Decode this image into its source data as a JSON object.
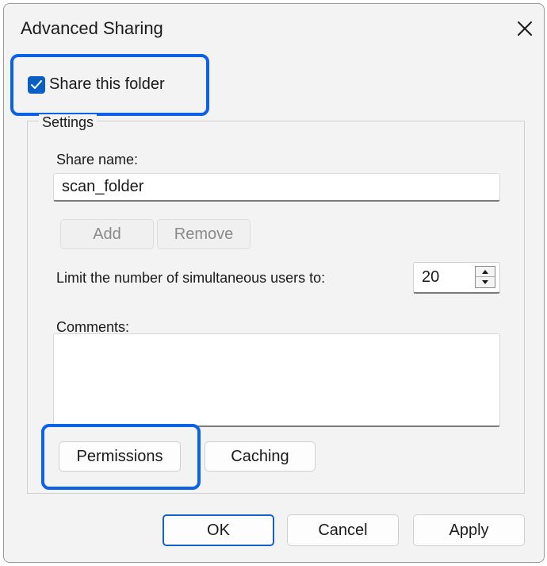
{
  "window": {
    "title": "Advanced Sharing",
    "close_icon": "close-icon"
  },
  "share": {
    "checkbox_label": "Share this folder",
    "checked": true
  },
  "settings": {
    "group_label": "Settings",
    "share_name_label": "Share name:",
    "share_name_value": "scan_folder",
    "add_label": "Add",
    "remove_label": "Remove",
    "limit_label": "Limit the number of simultaneous users to:",
    "limit_value": "20",
    "comments_label": "Comments:",
    "comments_value": "",
    "permissions_label": "Permissions",
    "caching_label": "Caching"
  },
  "footer": {
    "ok_label": "OK",
    "cancel_label": "Cancel",
    "apply_label": "Apply"
  },
  "colors": {
    "accent": "#0a5fc4",
    "highlight": "#0a63e6",
    "window_bg": "#f3f3f3"
  }
}
